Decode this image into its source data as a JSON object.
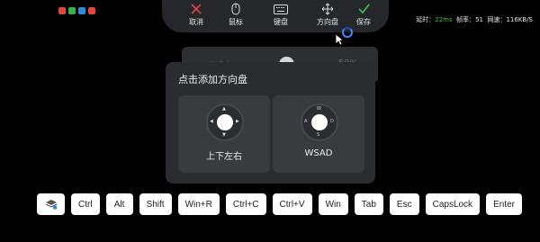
{
  "toolbar": {
    "cancel": "取消",
    "mouse": "鼠标",
    "keyboard": "键盘",
    "dpad": "方向盘",
    "save": "保存"
  },
  "stats": {
    "latency_label": "延时：",
    "latency_value": "22ms",
    "fps_label": "帧率：",
    "fps_value": "51",
    "speed_label": "网速：",
    "speed_value": "116KB/S"
  },
  "opacity": {
    "label": "不透明度",
    "value": "50%",
    "level": 0.5
  },
  "dialog": {
    "title": "点击添加方向盘",
    "options": [
      {
        "label": "上下左右"
      },
      {
        "label": "WSAD",
        "letters": [
          "W",
          "S",
          "A",
          "D"
        ]
      }
    ]
  },
  "keys": [
    "Ctrl",
    "Alt",
    "Shift",
    "Win+R",
    "Ctrl+C",
    "Ctrl+V",
    "Win",
    "Tab",
    "Esc",
    "CapsLock",
    "Enter"
  ],
  "colors": {
    "cancel": "#e04646",
    "save": "#3fbf5a",
    "latency": "#3fbf5a",
    "accent": "#3c8bff"
  }
}
